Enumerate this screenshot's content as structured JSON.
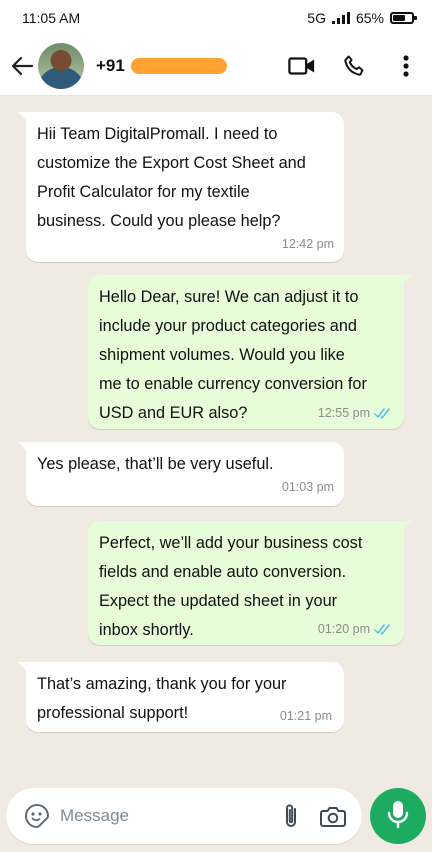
{
  "status_bar": {
    "time": "11:05 AM",
    "network": "5G",
    "battery_percent": "65%",
    "battery_level": 0.65
  },
  "header": {
    "contact_prefix": "+91",
    "icons": [
      "back-arrow-icon",
      "video-call-icon",
      "phone-icon",
      "more-vert-icon"
    ]
  },
  "colors": {
    "chat_background": "#efeae2",
    "incoming_bubble": "#ffffff",
    "outgoing_bubble": "#e7fcd8",
    "read_ticks": "#53bdeb",
    "mic_button": "#1daa61"
  },
  "messages": [
    {
      "direction": "incoming",
      "text": "Hii Team DigitalPromall. I need to\ncustomize the Export Cost Sheet and\nProfit Calculator for my textile\nbusiness. Could you please help?",
      "time": "12:42 pm"
    },
    {
      "direction": "outgoing",
      "text": "Hello Dear, sure! We can adjust it to\ninclude your product categories and\nshipment volumes. Would you like\nme to enable currency conversion for\nUSD and EUR also?",
      "time": "12:55 pm",
      "status": "read"
    },
    {
      "direction": "incoming",
      "text": "Yes please, that’ll be very useful.",
      "time": "01:03 pm"
    },
    {
      "direction": "outgoing",
      "text": "Perfect, we’ll add your business cost\nfields and enable auto conversion.\nExpect the updated sheet in your\ninbox shortly.",
      "time": "01:20 pm",
      "status": "read"
    },
    {
      "direction": "incoming",
      "text": "That’s amazing, thank you for your\nprofessional support!",
      "time": "01:21 pm"
    }
  ],
  "composer": {
    "placeholder": "Message",
    "value": ""
  }
}
